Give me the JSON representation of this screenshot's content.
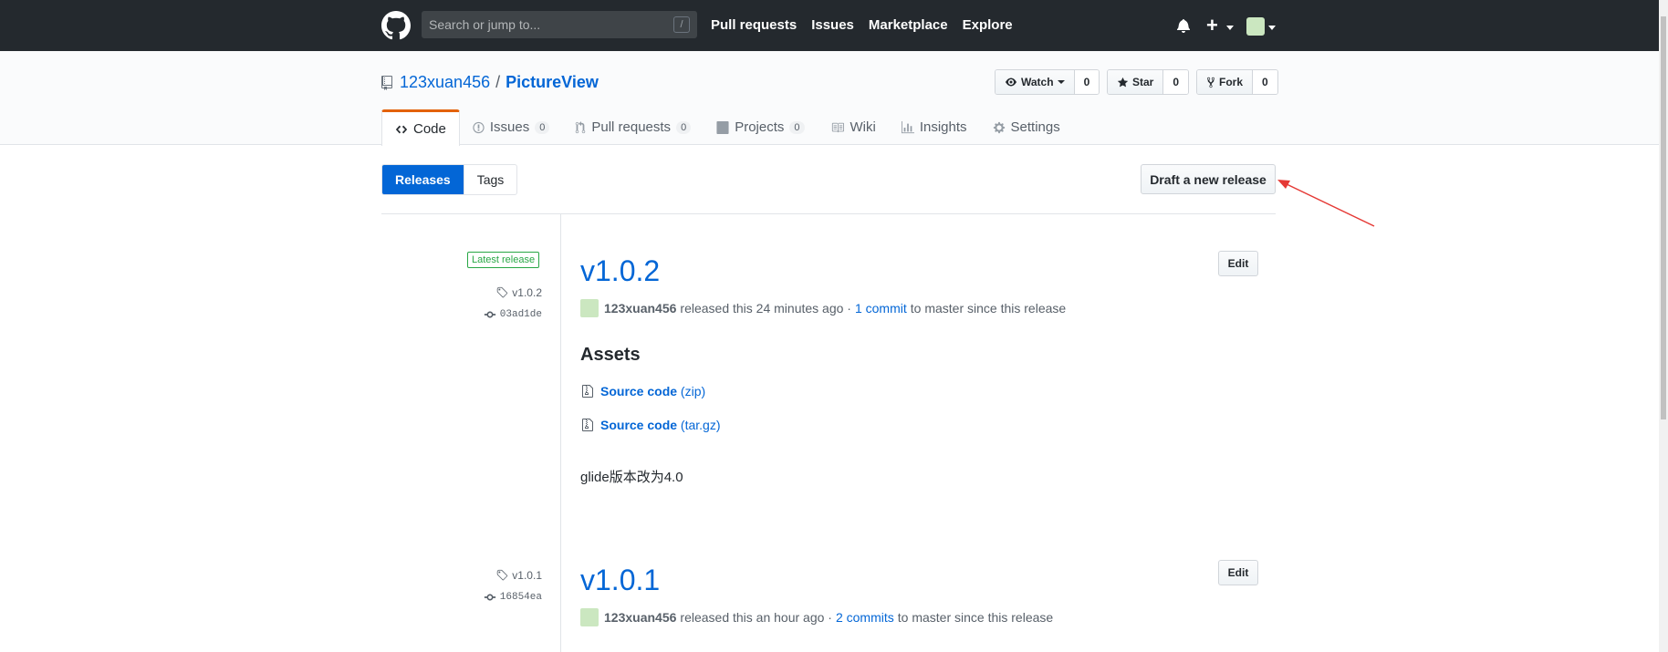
{
  "header": {
    "search_placeholder": "Search or jump to...",
    "search_key": "/",
    "nav": [
      "Pull requests",
      "Issues",
      "Marketplace",
      "Explore"
    ]
  },
  "repo": {
    "owner": "123xuan456",
    "separator": "/",
    "name": "PictureView",
    "watch_label": "Watch",
    "watch_count": "0",
    "star_label": "Star",
    "star_count": "0",
    "fork_label": "Fork",
    "fork_count": "0"
  },
  "tabs": [
    {
      "label": "Code"
    },
    {
      "label": "Issues",
      "count": "0"
    },
    {
      "label": "Pull requests",
      "count": "0"
    },
    {
      "label": "Projects",
      "count": "0"
    },
    {
      "label": "Wiki"
    },
    {
      "label": "Insights"
    },
    {
      "label": "Settings"
    }
  ],
  "subnav": {
    "releases": "Releases",
    "tags": "Tags",
    "draft_button": "Draft a new release"
  },
  "releases": [
    {
      "latest_label": "Latest release",
      "tag": "v1.0.2",
      "commit": "03ad1de",
      "title": "v1.0.2",
      "author": "123xuan456",
      "released_text": "released this 24 minutes ago ·",
      "commits_link": "1 commit",
      "since_text": "to master since this release",
      "edit_label": "Edit",
      "assets_title": "Assets",
      "assets": [
        {
          "name": "Source code",
          "ext": "(zip)"
        },
        {
          "name": "Source code",
          "ext": "(tar.gz)"
        }
      ],
      "body": "glide版本改为4.0"
    },
    {
      "tag": "v1.0.1",
      "commit": "16854ea",
      "title": "v1.0.1",
      "author": "123xuan456",
      "released_text": "released this an hour ago ·",
      "commits_link": "2 commits",
      "since_text": "to master since this release",
      "edit_label": "Edit"
    }
  ],
  "colors": {
    "header_bg": "#24292e",
    "link": "#0366d6",
    "active_tab_accent": "#e36209",
    "latest_green": "#28a745",
    "annotation_arrow": "#e53935"
  }
}
